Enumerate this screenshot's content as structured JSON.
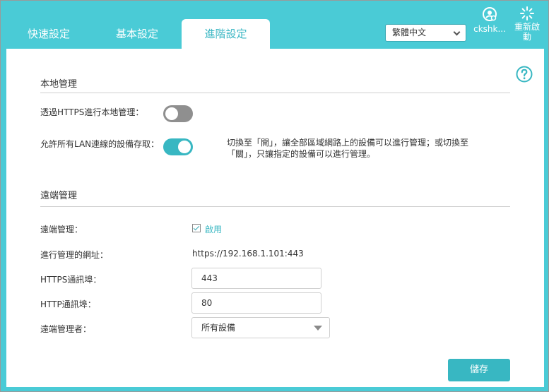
{
  "header": {
    "tabs": [
      {
        "label": "快速設定"
      },
      {
        "label": "基本設定"
      },
      {
        "label": "進階設定"
      }
    ],
    "language_select": {
      "value": "繁體中文"
    },
    "user_label": "ckshk...",
    "reboot_label": "重新啟動"
  },
  "local_mgmt": {
    "title": "本地管理",
    "https_label": "透過HTTPS進行本地管理：",
    "https_enabled": false,
    "lan_label": "允許所有LAN連線的設備存取：",
    "lan_enabled": true,
    "hint": "切換至「開」，讓全部區域網路上的設備可以進行管理；或切換至「關」，只讓指定的設備可以進行管理。"
  },
  "remote_mgmt": {
    "title": "遠端管理",
    "remote_label": "遠端管理：",
    "enable_label": "啟用",
    "enabled": true,
    "url_label": "進行管理的網址：",
    "url_value": "https://192.168.1.101:443",
    "https_port_label": "HTTPS通訊埠：",
    "https_port_value": "443",
    "http_port_label": "HTTP通訊埠：",
    "http_port_value": "80",
    "manager_label": "遠端管理者：",
    "manager_value": "所有設備"
  },
  "footer": {
    "save_label": "儲存"
  },
  "colors": {
    "accent": "#38b7c2",
    "header_bg": "#4acbd6",
    "toggle_off": "#8f8f8f"
  },
  "icons": {
    "user": "user-icon",
    "reboot": "reboot-icon",
    "help": "help-icon",
    "dropdown": "chevron-down-icon"
  }
}
